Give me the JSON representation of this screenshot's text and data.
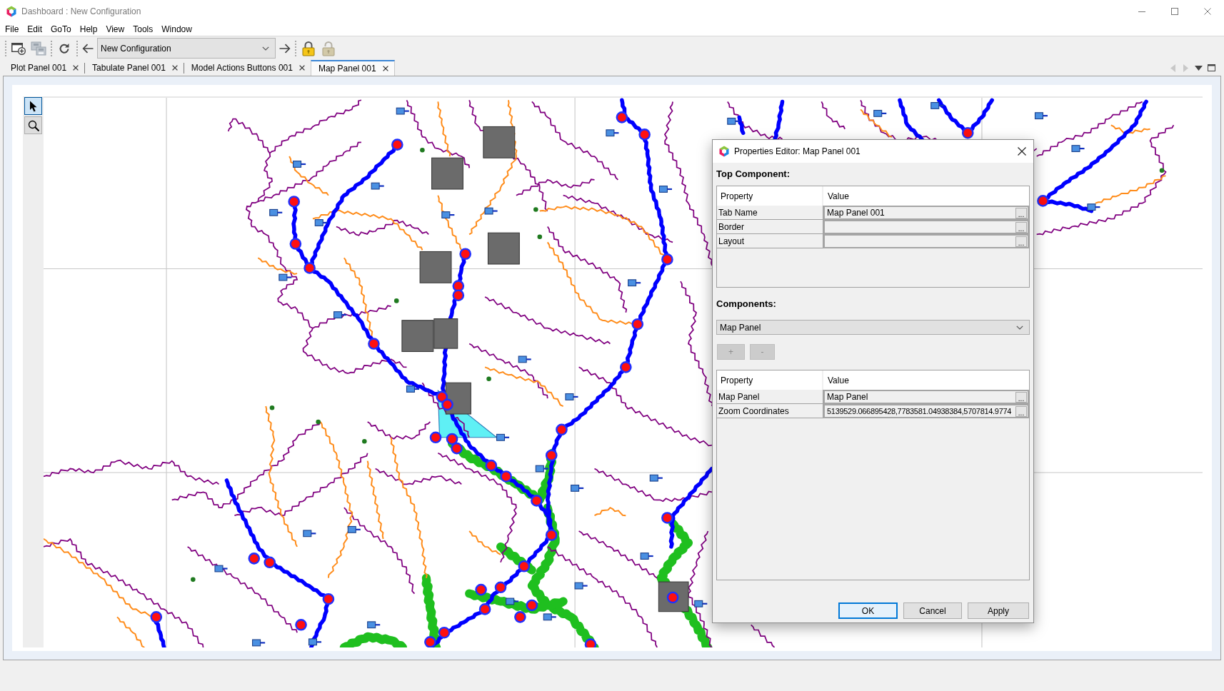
{
  "window": {
    "title": "Dashboard : New Configuration"
  },
  "menu": [
    "File",
    "Edit",
    "GoTo",
    "Help",
    "View",
    "Tools",
    "Window"
  ],
  "toolbar": {
    "groups": [
      [
        {
          "kind": "add_panel",
          "disabled": false
        },
        {
          "kind": "save",
          "disabled": true
        }
      ],
      [
        {
          "kind": "refresh",
          "disabled": false
        }
      ],
      [
        {
          "kind": "back",
          "disabled": false
        },
        {
          "kind": "combo",
          "value": "New Configuration",
          "disabled": false
        },
        {
          "kind": "forward",
          "disabled": false
        }
      ],
      [
        {
          "kind": "lock",
          "disabled": false
        },
        {
          "kind": "unlock",
          "disabled": true
        }
      ]
    ]
  },
  "tabs": [
    {
      "label": "Plot Panel 001",
      "selected": false
    },
    {
      "label": "Tabulate Panel 001",
      "selected": false
    },
    {
      "label": "Model Actions Buttons 001",
      "selected": false
    },
    {
      "label": "Map Panel 001",
      "selected": true
    }
  ],
  "tab_controls": [
    {
      "kind": "scroll_left",
      "disabled": true
    },
    {
      "kind": "scroll_right",
      "disabled": true
    },
    {
      "kind": "list",
      "disabled": false
    },
    {
      "kind": "maximize",
      "disabled": false
    }
  ],
  "map_tools": [
    {
      "kind": "pointer",
      "selected": true
    },
    {
      "kind": "zoom",
      "selected": false
    }
  ],
  "dialog": {
    "title": "Properties Editor: Map Panel 001",
    "top_component": {
      "heading": "Top Component:",
      "columns": [
        "Property",
        "Value"
      ],
      "rows": [
        {
          "property": "Tab Name",
          "value": "Map Panel 001",
          "button": "..."
        },
        {
          "property": "Border",
          "button": "..."
        },
        {
          "property": "Layout",
          "button": "..."
        }
      ]
    },
    "components": {
      "heading": "Components:",
      "selector": {
        "value": "Map Panel"
      },
      "buttons": [
        {
          "label": "+",
          "disabled": true
        },
        {
          "label": "-",
          "disabled": true
        }
      ],
      "columns": [
        "Property",
        "Value"
      ],
      "rows": [
        {
          "property": "Map Panel",
          "value": "Map Panel",
          "button": "..."
        },
        {
          "property": "Zoom Coordinates",
          "value": "5139529.066895428,7783581.04938384,5707814.9774",
          "button": "..."
        }
      ]
    },
    "buttons": [
      {
        "label": "OK",
        "default": true
      },
      {
        "label": "Cancel",
        "default": false
      },
      {
        "label": "Apply",
        "default": false
      }
    ]
  }
}
